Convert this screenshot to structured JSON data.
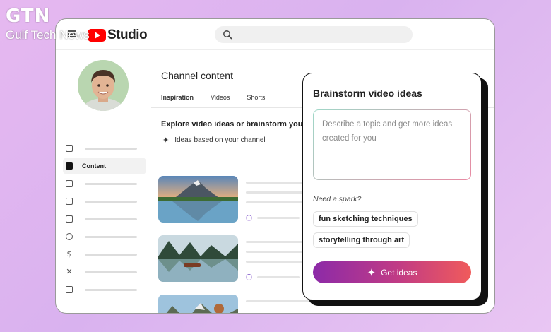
{
  "watermark": {
    "logo": "GTN",
    "name": "Gulf Tech News"
  },
  "header": {
    "app_name": "Studio",
    "search_placeholder": ""
  },
  "sidebar": {
    "active_label": "Content"
  },
  "main": {
    "title": "Channel content",
    "tabs": [
      {
        "label": "Inspiration",
        "active": true
      },
      {
        "label": "Videos",
        "active": false
      },
      {
        "label": "Shorts",
        "active": false
      }
    ],
    "explore_title": "Explore video ideas or brainstorm you",
    "ideas_label": "Ideas based on your channel"
  },
  "brainstorm": {
    "title": "Brainstorm video ideas",
    "input_placeholder": "Describe a topic and get more ideas created for you",
    "spark_label": "Need a spark?",
    "suggestions": [
      "fun sketching techniques",
      "storytelling through art"
    ],
    "button_label": "Get ideas"
  },
  "colors": {
    "youtube_red": "#ff0000",
    "button_gradient_start": "#8c2aa8",
    "button_gradient_end": "#f05b5b",
    "background": "#dcb4ef"
  }
}
